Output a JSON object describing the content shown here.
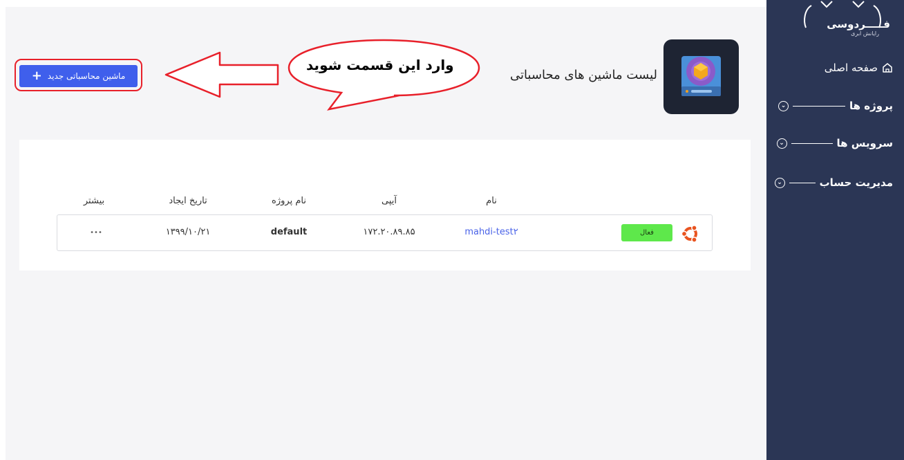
{
  "sidebar": {
    "logo_title": "فـــــردوسی",
    "logo_subtitle": "رایانش ابری",
    "items": [
      {
        "label": "صفحه اصلی",
        "icon": "home-icon"
      },
      {
        "label": "پروژه ها",
        "icon": "chevron-circle-icon"
      },
      {
        "label": "سرویس ها",
        "icon": "chevron-circle-icon"
      },
      {
        "label": "مدیریت حساب",
        "icon": "chevron-circle-icon"
      }
    ]
  },
  "header": {
    "title": "لیست ماشین های محاسباتی",
    "new_button_label": "ماشین محاسباتی جدید",
    "new_button_icon": "plus-icon"
  },
  "annotation": {
    "callout_text": "وارد این قسمت شوید",
    "color": "#e8202a"
  },
  "table": {
    "columns": [
      "نام",
      "آیپی",
      "نام پروژه",
      "تاریخ ایجاد",
      "بیشتر"
    ],
    "rows": [
      {
        "status": "فعال",
        "name": "mahdi-test۲",
        "ip": "۱۷۲.۲۰.۸۹.۸۵",
        "project": "default",
        "created": "۱۳۹۹/۱۰/۲۱",
        "more": "•••",
        "os_icon": "ubuntu-icon"
      }
    ]
  },
  "colors": {
    "sidebar_bg": "#2b3655",
    "primary_button": "#3f5fec",
    "status_active": "#5ee84b",
    "link": "#4a63e8"
  }
}
